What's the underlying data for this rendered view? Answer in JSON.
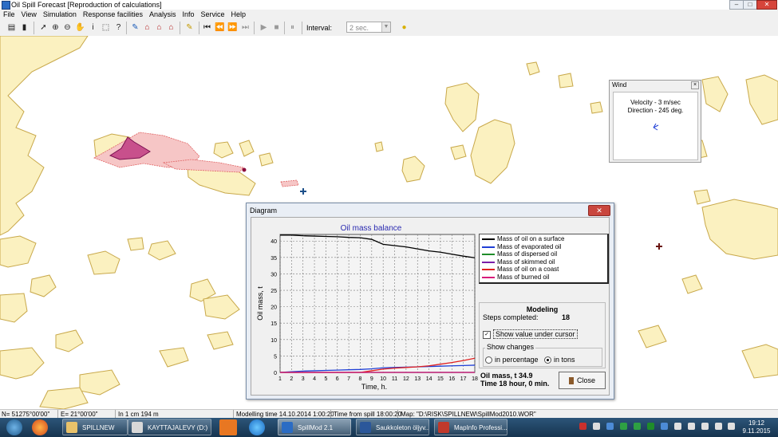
{
  "window": {
    "title": "Oil Spill Forecast [Reproduction of calculations]",
    "controls": [
      "minimize-icon",
      "maximize-icon",
      "close-icon"
    ]
  },
  "menu": [
    "File",
    "View",
    "Simulation",
    "Response facilities",
    "Analysis",
    "Info",
    "Service",
    "Help"
  ],
  "toolbar": {
    "interval_label": "Interval:",
    "interval_value": "2 sec."
  },
  "wind": {
    "title": "Wind",
    "velocity": "Velocity - 3 m/sec",
    "direction": "Direction - 245 deg."
  },
  "diagram": {
    "title": "Diagram",
    "close_label": "Close",
    "modeling": {
      "heading": "Modeling",
      "steps_label": "Steps completed:",
      "steps_value": "18",
      "show_value_label": "Show value under cursor",
      "show_value_checked": true,
      "changes_group": "Show changes",
      "option_percentage": "in percentage",
      "option_tons": "in tons",
      "selected_option": "in tons"
    },
    "result_mass": "Oil mass, t 34.9",
    "result_time": "Time 18 hour, 0 min."
  },
  "chart_data": {
    "type": "line",
    "title": "Oil mass balance",
    "xlabel": "Time, h.",
    "ylabel": "Oil mass, t",
    "x": [
      1,
      2,
      3,
      4,
      5,
      6,
      7,
      8,
      9,
      10,
      11,
      12,
      13,
      14,
      15,
      16,
      17,
      18
    ],
    "xlim": [
      1,
      18
    ],
    "ylim": [
      0,
      42
    ],
    "yticks": [
      0,
      5,
      10,
      15,
      20,
      25,
      30,
      35,
      40
    ],
    "grid": true,
    "legend_position": "right",
    "series": [
      {
        "name": "Mass of oil on a surface",
        "color": "#000000",
        "values": [
          41.8,
          41.8,
          41.6,
          41.5,
          41.4,
          41.3,
          41.1,
          41.0,
          40.5,
          39.0,
          38.6,
          38.2,
          37.6,
          37.0,
          36.6,
          36.0,
          35.4,
          34.9
        ]
      },
      {
        "name": "Mass of evaporated oil",
        "color": "#1f3fd6",
        "values": [
          0.0,
          0.2,
          0.4,
          0.5,
          0.6,
          0.7,
          0.8,
          0.9,
          1.1,
          1.4,
          1.5,
          1.6,
          1.7,
          1.8,
          1.9,
          2.0,
          2.1,
          2.2
        ]
      },
      {
        "name": "Mass of dispersed oil",
        "color": "#1f8c2a",
        "values": [
          0,
          0,
          0,
          0,
          0,
          0,
          0,
          0,
          0,
          0,
          0,
          0,
          0,
          0,
          0,
          0,
          0,
          0
        ]
      },
      {
        "name": "Mass of skimmed oil",
        "color": "#7a1ea8",
        "values": [
          0,
          0,
          0,
          0,
          0,
          0,
          0,
          0,
          0,
          0,
          0,
          0,
          0,
          0,
          0,
          0,
          0,
          0
        ]
      },
      {
        "name": "Mass of oil on a coast",
        "color": "#e02020",
        "values": [
          0.0,
          0.0,
          0.0,
          0.0,
          0.0,
          0.0,
          0.0,
          0.0,
          0.5,
          1.0,
          1.3,
          1.5,
          1.7,
          2.0,
          2.5,
          3.0,
          3.6,
          4.3
        ]
      },
      {
        "name": "Mass of burned oil",
        "color": "#d81b7a",
        "values": [
          0,
          0,
          0,
          0,
          0,
          0,
          0,
          0,
          0,
          0,
          0,
          0,
          0,
          0,
          0,
          0,
          0,
          0
        ]
      }
    ]
  },
  "status": {
    "north": "N= 51275°00'00\"",
    "east": "E= 21°00'00\"",
    "scale": "In 1 cm  194 m",
    "modelling_time": "Modelling time 14.10.2014 1:00:20",
    "time_from_spill": "Time from spill  18:00:20",
    "map_path": "Map:  \"D:\\RISK\\SPILLNEW\\SpillMod2010.WOR\""
  },
  "taskbar": {
    "items": [
      "SPILLNEW",
      "KAYTTAJALEVY (D:)",
      "SpillMod 2.1",
      "Saukkoleton öljyv...",
      "MapInfo Professi..."
    ],
    "time": "19:12",
    "date": "9.11.2015"
  }
}
